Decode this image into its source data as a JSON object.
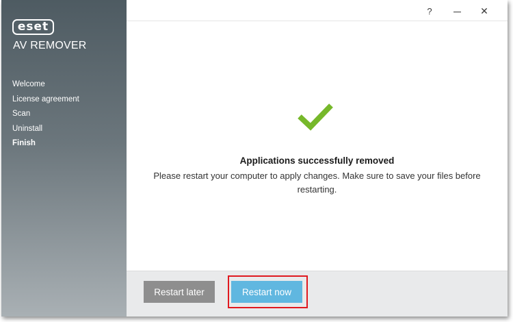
{
  "sidebar": {
    "logo_text": "eset",
    "product_name": "AV REMOVER",
    "steps": [
      {
        "label": "Welcome"
      },
      {
        "label": "License agreement"
      },
      {
        "label": "Scan"
      },
      {
        "label": "Uninstall"
      },
      {
        "label": "Finish",
        "active": true
      }
    ]
  },
  "titlebar": {
    "help": "?",
    "close": "✕"
  },
  "main": {
    "status_icon": "checkmark-icon",
    "title": "Applications successfully removed",
    "message": "Please restart your computer to apply changes. Make sure to save your files before restarting."
  },
  "footer": {
    "restart_later": "Restart later",
    "restart_now": "Restart now"
  },
  "colors": {
    "accent": "#60b7e0",
    "success": "#76b82a",
    "highlight": "#e0191f",
    "secondary_button": "#8e8e8e"
  }
}
